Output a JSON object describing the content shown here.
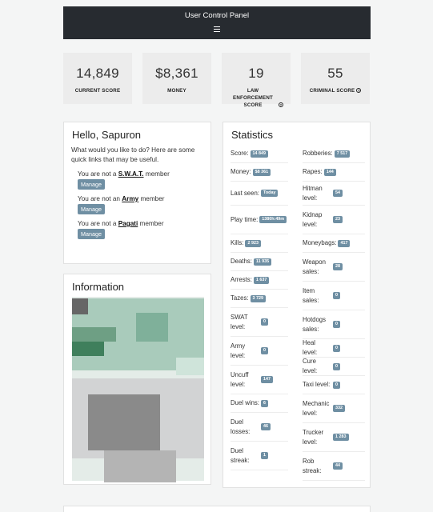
{
  "header": {
    "title": "User Control Panel",
    "menu_icon": "hamburger-icon"
  },
  "summary": [
    {
      "value": "14,849",
      "label": "CURRENT SCORE"
    },
    {
      "value": "$8,361",
      "label": "MONEY"
    },
    {
      "value": "19",
      "label": "LAW ENFORCEMENT SCORE"
    },
    {
      "value": "55",
      "label": "CRIMINAL SCORE"
    }
  ],
  "hello": {
    "title": "Hello, Sapuron",
    "intro": "What would you like to do? Here are some quick links that may be useful.",
    "memberships": [
      {
        "prefix": "You are not a ",
        "group": "S.W.A.T.",
        "suffix": " member",
        "button": "Manage"
      },
      {
        "prefix": "You are not an ",
        "group": "Army",
        "suffix": " member",
        "button": "Manage"
      },
      {
        "prefix": "You are not a ",
        "group": "Pagati",
        "suffix": " member",
        "button": "Manage"
      }
    ]
  },
  "info": {
    "title": "Information"
  },
  "statistics": {
    "title": "Statistics",
    "left": [
      {
        "label": "Score:",
        "value": "14 849"
      },
      {
        "label": "Money:",
        "value": "$8 361"
      },
      {
        "label": "Last seen:",
        "value": "Today"
      },
      {
        "label": "Play time:",
        "value": "1380h:49m"
      },
      {
        "label": "Kills:",
        "value": "2 923"
      },
      {
        "label": "Deaths:",
        "value": "11 935"
      },
      {
        "label": "Arrests:",
        "value": "1 637"
      },
      {
        "label": "Tazes:",
        "value": "3 729"
      },
      {
        "label": "SWAT level:",
        "value": "0"
      },
      {
        "label": "Army level:",
        "value": "0"
      },
      {
        "label": "Uncuff level:",
        "value": "147"
      },
      {
        "label": "Duel wins:",
        "value": "6"
      },
      {
        "label": "Duel losses:",
        "value": "46"
      },
      {
        "label": "Duel streak:",
        "value": "1"
      }
    ],
    "right": [
      {
        "label": "Robberies:",
        "value": "7 517"
      },
      {
        "label": "Rapes:",
        "value": "144"
      },
      {
        "label": "Hitman level:",
        "value": "54"
      },
      {
        "label": "Kidnap level:",
        "value": "23"
      },
      {
        "label": "Moneybags:",
        "value": "417"
      },
      {
        "label": "Weapon sales:",
        "value": "28"
      },
      {
        "label": "Item sales:",
        "value": "0"
      },
      {
        "label": "Hotdogs sales:",
        "value": "0"
      },
      {
        "label": "Heal level:",
        "value": "0"
      },
      {
        "label": "Cure level:",
        "value": "0"
      },
      {
        "label": "Taxi level:",
        "value": "0"
      },
      {
        "label": "Mechanic level:",
        "value": "332"
      },
      {
        "label": "Trucker level:",
        "value": "1 283"
      },
      {
        "label": "Rob streak:",
        "value": "44"
      }
    ]
  }
}
